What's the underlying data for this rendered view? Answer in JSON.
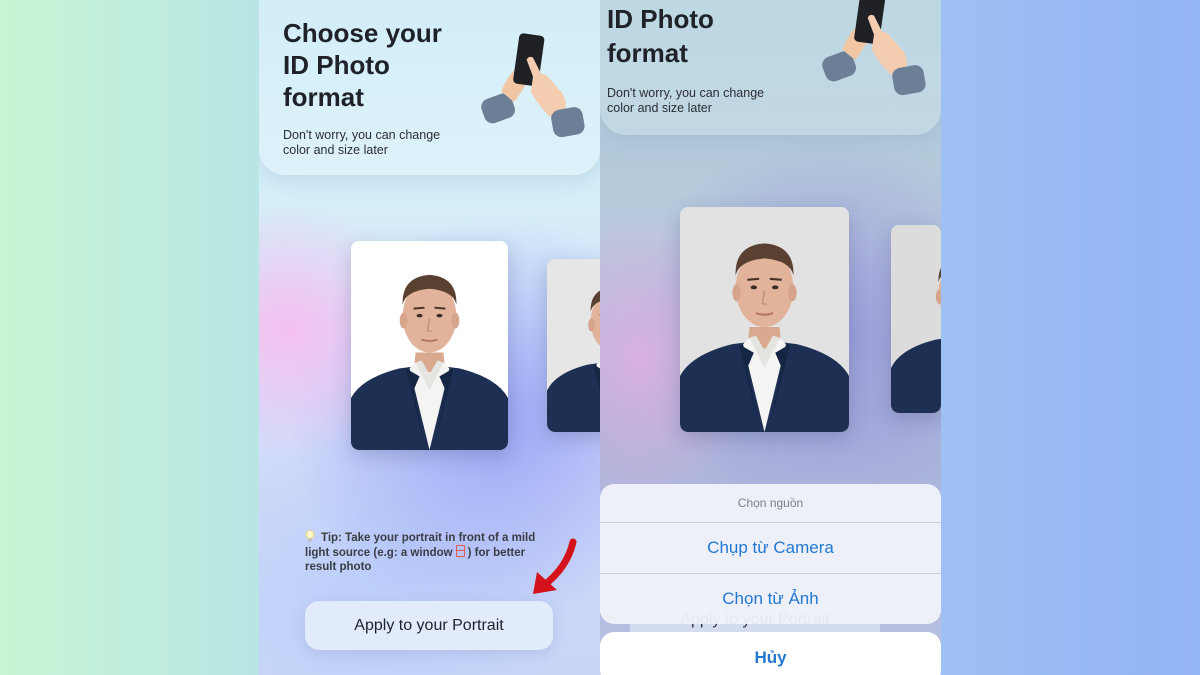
{
  "left_screen": {
    "title_lines": [
      "Choose your",
      "ID Photo",
      "format"
    ],
    "subtitle_lines": [
      "Don't worry, you can change",
      "color and size later"
    ],
    "tip_line1": "Tip: Take your portrait in front of a mild",
    "tip_line2_a": "light source (e.g: a window",
    "tip_line2_b": ") for better",
    "tip_line3": "result photo",
    "apply_button": "Apply to your Portrait"
  },
  "right_screen": {
    "title_lines": [
      "ID Photo",
      "format"
    ],
    "subtitle_lines": [
      "Don't worry, you can change",
      "color and size later"
    ],
    "behind_button": "Apply to your Portrait",
    "action_sheet": {
      "title": "Chọn nguồn",
      "options": [
        "Chụp từ Camera",
        "Chọn từ Ảnh"
      ],
      "cancel": "Hủy"
    }
  },
  "colors": {
    "accent_blue": "#2378d2",
    "arrow_red": "#d4121b",
    "suit_navy": "#1d2f52"
  },
  "icons": [
    "hands-holding-phone-icon",
    "lightbulb-icon",
    "window-icon",
    "red-arrow-icon"
  ]
}
